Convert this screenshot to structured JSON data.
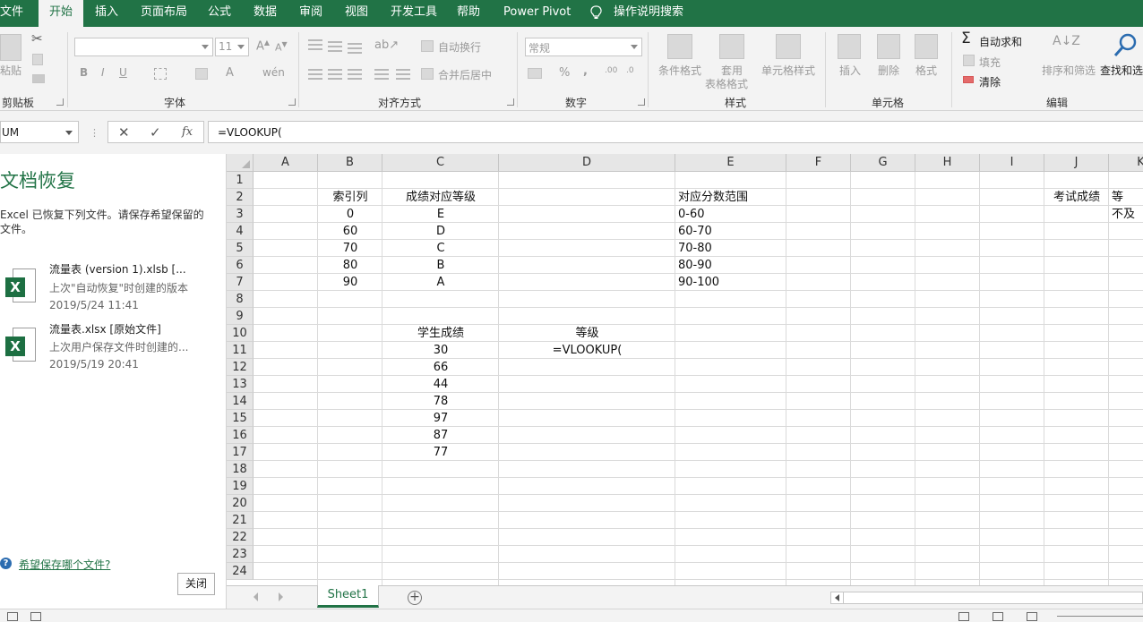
{
  "ribbon_tabs": [
    "文件",
    "开始",
    "插入",
    "页面布局",
    "公式",
    "数据",
    "审阅",
    "视图",
    "开发工具",
    "帮助",
    "Power Pivot",
    "操作说明搜索"
  ],
  "active_tab": "开始",
  "ribbon": {
    "clipboard": {
      "paste": "粘贴",
      "label": "剪贴板"
    },
    "font": {
      "size": "11",
      "bold": "B",
      "italic": "I",
      "underline": "U",
      "label": "字体"
    },
    "alignment": {
      "wrap_text": "自动换行",
      "merge_center": "合并后居中",
      "label": "对齐方式"
    },
    "number": {
      "format": "常规",
      "percent": "%",
      "comma": ",",
      "label": "数字"
    },
    "styles": {
      "conditional": "条件格式",
      "table_line1": "套用",
      "table_line2": "表格格式",
      "cell_styles": "单元格样式",
      "label": "样式"
    },
    "cells": {
      "insert": "插入",
      "delete": "删除",
      "format": "格式",
      "label": "单元格"
    },
    "editing": {
      "autosum": "自动求和",
      "fill": "填充",
      "clear": "清除",
      "sort_filter": "排序和筛选",
      "find_select": "查找和选",
      "label": "编辑"
    }
  },
  "formula_bar": {
    "name_box": "UM",
    "cancel": "✕",
    "enter": "✓",
    "fx": "fx",
    "formula": "=VLOOKUP("
  },
  "recovery": {
    "title": "文档恢复",
    "description_line1": "Excel 已恢复下列文件。请保存希望保留的",
    "description_line2": "文件。",
    "files": [
      {
        "name": "流量表 (version 1).xlsb  [...",
        "status": "上次\"自动恢复\"时创建的版本",
        "date": "2019/5/24 11:41"
      },
      {
        "name": "流量表.xlsx  [原始文件]",
        "status": "上次用户保存文件时创建的...",
        "date": "2019/5/19 20:41"
      }
    ],
    "help_link": "希望保存哪个文件?",
    "close_button": "关闭"
  },
  "grid": {
    "columns": [
      "A",
      "B",
      "C",
      "D",
      "E",
      "F",
      "G",
      "H",
      "I",
      "J",
      "K"
    ],
    "rows": [
      "1",
      "2",
      "3",
      "4",
      "5",
      "6",
      "7",
      "8",
      "9",
      "10",
      "11",
      "12",
      "13",
      "14",
      "15",
      "16",
      "17",
      "18",
      "19",
      "20",
      "21",
      "22",
      "23",
      "24"
    ],
    "cells": {
      "B2": "索引列",
      "C2": "成绩对应等级",
      "E2": "对应分数范围",
      "J2": "考试成绩",
      "K2": "等",
      "B3": "0",
      "C3": "E",
      "E3": "0-60",
      "K3": "不及",
      "B4": "60",
      "C4": "D",
      "E4": "60-70",
      "B5": "70",
      "C5": "C",
      "E5": "70-80",
      "B6": "80",
      "C6": "B",
      "E6": "80-90",
      "B7": "90",
      "C7": "A",
      "E7": "90-100",
      "C10": "学生成绩",
      "D10": "等级",
      "C11": "30",
      "D11": "=VLOOKUP(",
      "C12": "66",
      "C13": "44",
      "C14": "78",
      "C15": "97",
      "C16": "87",
      "C17": "77"
    }
  },
  "sheet_tabs": {
    "active": "Sheet1",
    "add": "+"
  }
}
